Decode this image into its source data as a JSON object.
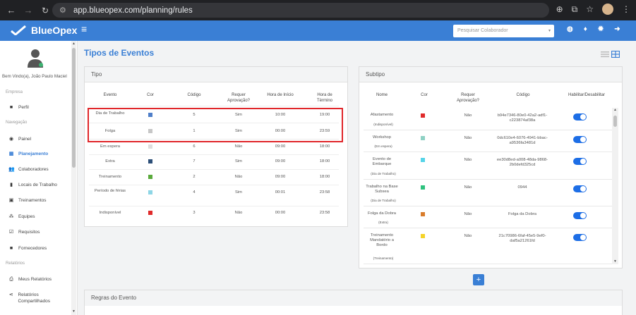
{
  "browser": {
    "url": "app.blueopex.com/planning/rules"
  },
  "app": {
    "brand": "BlueOpex",
    "search_placeholder": "Pesquisar Colaborador",
    "colors": {
      "primary": "#3a7fd5",
      "highlight": "#e0262a",
      "toggle": "#1d6ee6"
    }
  },
  "sidebar": {
    "welcome": "Bem Vindo(a), João Paulo Maciel",
    "sections": {
      "empresa": "Empresa",
      "navegacao": "Navegação",
      "relatorios": "Relatórios"
    },
    "items": [
      {
        "label": "Perfil",
        "icon": "briefcase-icon"
      },
      {
        "label": "Painel",
        "icon": "gauge-icon"
      },
      {
        "label": "Planejamento",
        "icon": "grid-icon",
        "active": true
      },
      {
        "label": "Colaboradores",
        "icon": "users-icon"
      },
      {
        "label": "Locais de Trabalho",
        "icon": "building-icon"
      },
      {
        "label": "Treinamentos",
        "icon": "training-icon"
      },
      {
        "label": "Equipes",
        "icon": "team-icon"
      },
      {
        "label": "Requisitos",
        "icon": "checkbox-icon"
      },
      {
        "label": "Fornecedores",
        "icon": "briefcase-icon"
      },
      {
        "label": "Meus Relatórios",
        "icon": "print-icon"
      },
      {
        "label": "Relatórios Compartilhados",
        "icon": "share-icon"
      }
    ]
  },
  "page": {
    "title": "Tipos de Eventos"
  },
  "tipo": {
    "title": "Tipo",
    "columns": [
      "Evento",
      "Cor",
      "Código",
      "Requer Aprovação?",
      "Hora de Início",
      "Hora de Término"
    ],
    "rows": [
      {
        "evento": "Dia de Trabalho",
        "cor": "#4f7fc9",
        "codigo": "5",
        "aprov": "Sim",
        "inicio": "10:00",
        "fim": "19:00"
      },
      {
        "evento": "Folga",
        "cor": "#c7c7c7",
        "codigo": "1",
        "aprov": "Sim",
        "inicio": "00:00",
        "fim": "23:59"
      },
      {
        "evento": "Em espera",
        "cor": "#dedede",
        "codigo": "6",
        "aprov": "Não",
        "inicio": "09:00",
        "fim": "18:00"
      },
      {
        "evento": "Extra",
        "cor": "#2d4f78",
        "codigo": "7",
        "aprov": "Sim",
        "inicio": "09:00",
        "fim": "18:00"
      },
      {
        "evento": "Treinamento",
        "cor": "#5aaa3c",
        "codigo": "2",
        "aprov": "Não",
        "inicio": "09:00",
        "fim": "18:00"
      },
      {
        "evento": "Período de férias",
        "cor": "#8ed6e6",
        "codigo": "4",
        "aprov": "Sim",
        "inicio": "00:01",
        "fim": "23:58"
      },
      {
        "evento": "Indisponível",
        "cor": "#e02a2a",
        "codigo": "3",
        "aprov": "Não",
        "inicio": "00:00",
        "fim": "23:58"
      }
    ]
  },
  "subtipo": {
    "title": "Subtipo",
    "columns": [
      "Nome",
      "Cor",
      "Requer Aprovação?",
      "Código",
      "Habilitar/Desabilitar"
    ],
    "rows": [
      {
        "nome": "Afastamento",
        "parent": "(Indisponível)",
        "cor": "#e02a2a",
        "aprov": "Não",
        "codigo": "b94e7346-80e0-42a2-adf1-c223874af38a",
        "enabled": true
      },
      {
        "nome": "Workshop",
        "parent": "(Em espera)",
        "cor": "#8fd1c4",
        "aprov": "Não",
        "codigo": "0dc610e4-6076-4941-bbac-a9536fa3481d",
        "enabled": true
      },
      {
        "nome": "Evento de Embarque",
        "parent": "(Dia de Trabalho)",
        "cor": "#56d4e8",
        "aprov": "Não",
        "codigo": "ee30d8ed-a008-48da-9868-2b0defd325cd",
        "enabled": true
      },
      {
        "nome": "Trabalho na Base Subsea",
        "parent": "(Dia de Trabalho)",
        "cor": "#2ec27e",
        "aprov": "Não",
        "codigo": "0944",
        "enabled": true
      },
      {
        "nome": "Folga da Dobra",
        "parent": "(Extra)",
        "cor": "#d97c2b",
        "aprov": "Não",
        "codigo": "Folga da Dobra",
        "enabled": true
      },
      {
        "nome": "Treinamento Mandatório a Bordo",
        "parent": "(Treinamento)",
        "cor": "#f5d328",
        "aprov": "Não",
        "codigo": "21c70986-6faf-45e5-9ef0-daf5a21261fd",
        "enabled": true
      }
    ],
    "add_label": "+"
  },
  "regras": {
    "title": "Regras do Evento"
  }
}
